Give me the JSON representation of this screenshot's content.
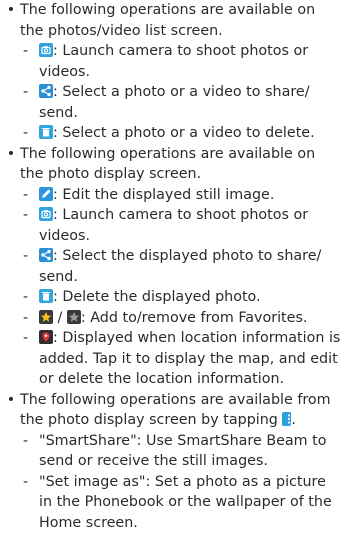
{
  "sections": [
    {
      "text": "The following operations are available on the photos/video list screen.",
      "items": [
        {
          "icon": "camera-icon",
          "text": ": Launch camera to shoot photos or videos."
        },
        {
          "icon": "share-icon",
          "text": ": Select a photo or a video to share/ send."
        },
        {
          "icon": "trash-icon",
          "text": ": Select a photo or a video to delete."
        }
      ]
    },
    {
      "text": "The following operations are available on the photo display screen.",
      "items": [
        {
          "icon": "edit-icon",
          "text": ": Edit the displayed still image."
        },
        {
          "icon": "camera-icon",
          "text": ": Launch camera to shoot photos or videos."
        },
        {
          "icon": "share-icon",
          "text": ": Select the displayed photo to share/ send."
        },
        {
          "icon": "trash-icon",
          "text": ": Delete the displayed photo."
        },
        {
          "icon": "favorite-icons",
          "separator": "/",
          "text": ": Add to/remove from Favorites."
        },
        {
          "icon": "location-icon",
          "text": ": Displayed when location information is added. Tap it to display the map, and edit or delete the location information."
        }
      ]
    },
    {
      "text": "The following operations are available from the photo display screen by tapping",
      "text_end": ".",
      "items": [
        {
          "text": "\"SmartShare\": Use SmartShare Beam to send or receive the still images."
        },
        {
          "text": "\"Set image as\": Set a photo as a picture in the Phonebook or the wallpaper of the Home screen."
        }
      ]
    }
  ],
  "bullet_char": "•",
  "dash_char": "-"
}
